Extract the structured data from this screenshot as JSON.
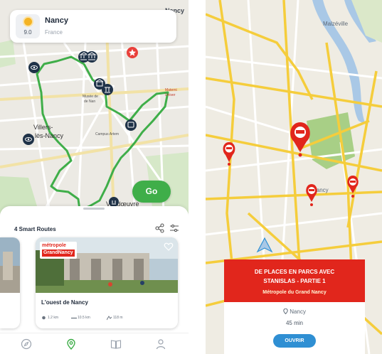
{
  "left_screen": {
    "city_card": {
      "weather_icon": "sun-icon",
      "temperature": "9.0",
      "city": "Nancy",
      "country": "France"
    },
    "map_labels": {
      "top_right": "Nancy",
      "museum": "Musée de\nde Nan",
      "villers_line1": "Villers-",
      "villers_line2": "lès-Nancy",
      "campus": "Campus Artem",
      "vandoeuvre": "Vandœuvre",
      "maternite": "Materni\nUniver"
    },
    "map_icons": [
      "eye-icon",
      "museum-icon",
      "museum-icon",
      "monument-icon",
      "bus-icon",
      "eye-icon",
      "star-icon",
      "monument-icon"
    ],
    "go_label": "Go",
    "smart_routes_title": "4 Smart Routes",
    "route_card": {
      "badge_line1": "métropole",
      "badge_line2": "GrandNancy",
      "title": "L'ouest de Nancy",
      "distance_1": "1.2 km",
      "distance_2": "10.5 km",
      "elevation": "118 m"
    },
    "tabs": [
      "compass-icon",
      "map-pin-icon",
      "book-icon",
      "user-icon"
    ],
    "accent_color": "#3fae49"
  },
  "right_screen": {
    "map_labels": {
      "malzeville": "Malzéville",
      "nancy": "Nancy"
    },
    "route_panel": {
      "title_line1": "DE PLACES EN PARCS AVEC",
      "title_line2": "STANISLAS - PARTIE 1",
      "organizer": "Métropole du Grand Nancy",
      "city": "Nancy",
      "duration": "45 min",
      "open_button": "OUVRIR"
    },
    "accent_color": "#e1261c",
    "button_color": "#2f8fd3"
  }
}
